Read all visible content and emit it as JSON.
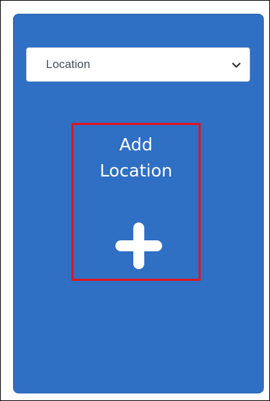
{
  "colors": {
    "card_bg": "#2f6fc4",
    "highlight_border": "#e3141c",
    "text_on_card": "#ffffff"
  },
  "location_select": {
    "selected": "Location",
    "icon": "chevron-down-icon"
  },
  "add_location": {
    "line1": "Add",
    "line2": "Location",
    "icon": "plus-icon"
  }
}
